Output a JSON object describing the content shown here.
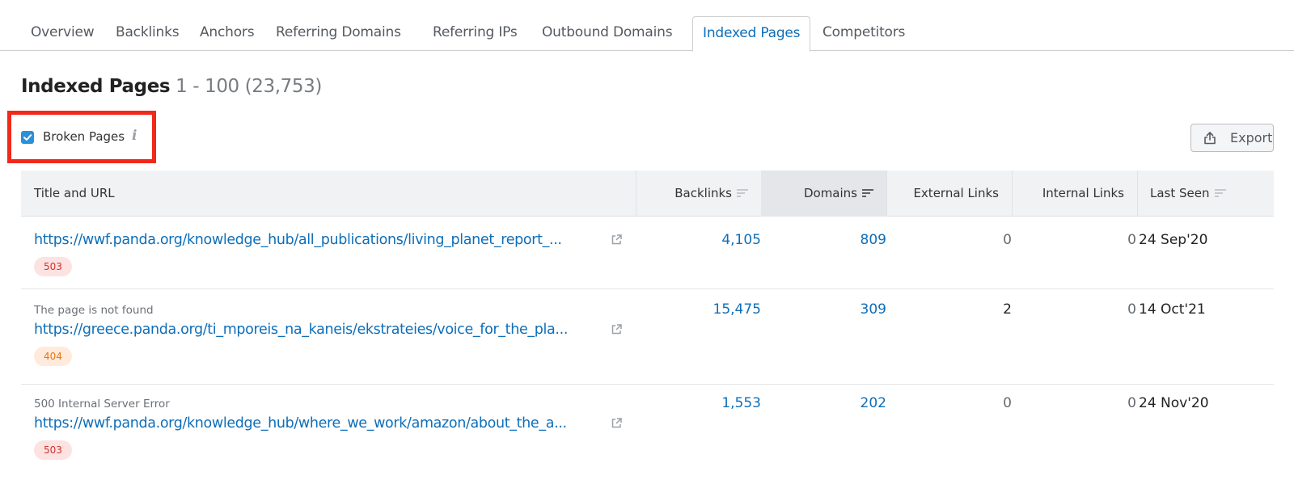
{
  "tabs": [
    {
      "label": "Overview",
      "active": false
    },
    {
      "label": "Backlinks",
      "active": false
    },
    {
      "label": "Anchors",
      "active": false
    },
    {
      "label": "Referring Domains",
      "active": false
    },
    {
      "label": "Referring IPs",
      "active": false
    },
    {
      "label": "Outbound Domains",
      "active": false
    },
    {
      "label": "Indexed Pages",
      "active": true
    },
    {
      "label": "Competitors",
      "active": false
    }
  ],
  "heading": {
    "title": "Indexed Pages",
    "range": "1 - 100 (23,753)"
  },
  "filter": {
    "label": "Broken Pages",
    "checked": true,
    "info_icon": "info-icon"
  },
  "export": {
    "label": "Export",
    "icon": "export-icon"
  },
  "table": {
    "columns": [
      {
        "label": "Title and URL",
        "sortable": false
      },
      {
        "label": "Backlinks",
        "sortable": true
      },
      {
        "label": "Domains",
        "sortable": true,
        "sorted": true
      },
      {
        "label": "External Links",
        "sortable": false
      },
      {
        "label": "Internal Links",
        "sortable": false
      },
      {
        "label": "Last Seen",
        "sortable": true
      }
    ],
    "rows": [
      {
        "title": "",
        "url": "https://wwf.panda.org/knowledge_hub/all_publications/living_planet_report_...",
        "status": "503",
        "backlinks": "4,105",
        "domains": "809",
        "external_links": "0",
        "internal_links": "0",
        "last_seen": "24 Sep'20"
      },
      {
        "title": "The page is not found",
        "url": "https://greece.panda.org/ti_mporeis_na_kaneis/ekstrateies/voice_for_the_pla...",
        "status": "404",
        "backlinks": "15,475",
        "domains": "309",
        "external_links": "2",
        "internal_links": "0",
        "last_seen": "14 Oct'21"
      },
      {
        "title": "500 Internal Server Error",
        "url": "https://wwf.panda.org/knowledge_hub/where_we_work/amazon/about_the_a...",
        "status": "503",
        "backlinks": "1,553",
        "domains": "202",
        "external_links": "0",
        "internal_links": "0",
        "last_seen": "24 Nov'20"
      }
    ]
  },
  "colors": {
    "accent": "#0e6eb8",
    "highlight_border": "#f2281a",
    "checkbox": "#2b8fd9",
    "badge_503_bg": "#fde2e2",
    "badge_503_text": "#d0302b",
    "badge_404_bg": "#ffeadb",
    "badge_404_text": "#e8760f"
  }
}
